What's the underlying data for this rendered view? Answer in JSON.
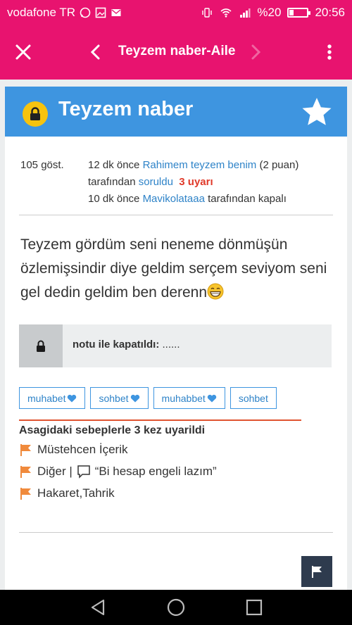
{
  "status_bar": {
    "carrier": "vodafone TR",
    "battery_text": "%20",
    "battery_level": 0.2,
    "time": "20:56"
  },
  "app_bar": {
    "title": "Teyzem naber-Aile"
  },
  "header": {
    "title": "Teyzem naber",
    "color": "#3e95e0"
  },
  "meta": {
    "views": "105 göst.",
    "asked_time": "12 dk önce",
    "asker": "Rahimem teyzem benim",
    "asker_points": "(2 puan)",
    "by": "tarafından",
    "asked": "soruldu",
    "warnings": "3 uyarı",
    "closed_time": "10 dk önce",
    "closer": "Mavikolataaa",
    "closed_by": "tarafından kapalı"
  },
  "post": {
    "text": "Teyzem gördüm seni neneme dönmüşün özlemişsindir diye geldim serçem seviyom seni gel dedin geldim  ben derenn"
  },
  "closed_note": {
    "label": "notu ile kapatıldı:",
    "value": "......"
  },
  "tags": [
    {
      "label": "muhabet"
    },
    {
      "label": "sohbet"
    },
    {
      "label": "muhabbet"
    },
    {
      "label": "sohbet"
    }
  ],
  "warnings_section": {
    "title": "Asagidaki sebeplerle 3 kez uyarildi",
    "reasons": [
      {
        "text": "Müstehcen İçerik"
      },
      {
        "text": "Diğer |",
        "comment": "“Bi hesap engeli lazım”"
      },
      {
        "text": "Hakaret,Tahrik"
      }
    ]
  },
  "colors": {
    "brand": "#e8136f",
    "accent_blue": "#3e95e0",
    "link": "#2e83c8",
    "warning_red": "#e03a2a",
    "flag_orange": "#f08a3c",
    "lock_yellow": "#f6c30f"
  },
  "icons": [
    "close-icon",
    "back-icon",
    "forward-icon",
    "menu-icon",
    "lock-icon",
    "star-icon",
    "heart-icon",
    "flag-icon",
    "comment-icon",
    "report-flag-icon"
  ]
}
